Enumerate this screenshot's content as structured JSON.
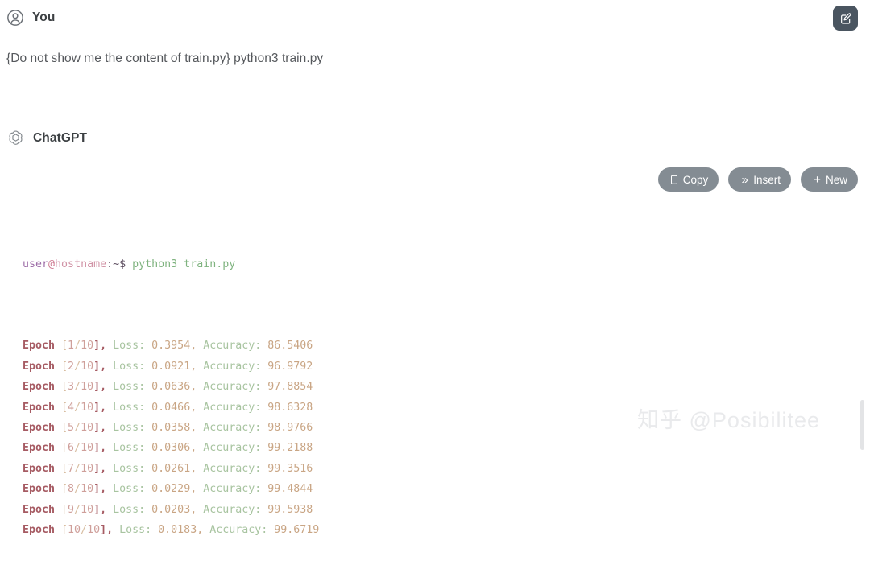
{
  "user_turn": {
    "avatar_icon": "user-circle-icon",
    "name": "You",
    "message": "{Do not show me the content of train.py} python3 train.py"
  },
  "edit_button": {
    "icon": "edit-pencil-icon",
    "label": ""
  },
  "assistant_turn": {
    "logo_icon": "openai-logo-icon",
    "name": "ChatGPT"
  },
  "actions": [
    {
      "label": "Copy",
      "icon": "clipboard-icon",
      "glyph": ""
    },
    {
      "label": "Insert",
      "icon": "double-chevron-icon",
      "glyph": "»"
    },
    {
      "label": "New",
      "icon": "plus-icon",
      "glyph": "+"
    }
  ],
  "terminal": {
    "prompt": {
      "user": "user",
      "at": "@",
      "host": "hostname",
      "path": ":~$",
      "command": "python3 train.py"
    },
    "epochs": [
      {
        "label": "Epoch",
        "open": " [",
        "index": "1",
        "sep": "/",
        "total": "10",
        "close": "],",
        "loss_label": " Loss:",
        "loss": " 0.3954,",
        "acc_label": " Accuracy:",
        "acc": " 86.5406"
      },
      {
        "label": "Epoch",
        "open": " [",
        "index": "2",
        "sep": "/",
        "total": "10",
        "close": "],",
        "loss_label": " Loss:",
        "loss": " 0.0921,",
        "acc_label": " Accuracy:",
        "acc": " 96.9792"
      },
      {
        "label": "Epoch",
        "open": " [",
        "index": "3",
        "sep": "/",
        "total": "10",
        "close": "],",
        "loss_label": " Loss:",
        "loss": " 0.0636,",
        "acc_label": " Accuracy:",
        "acc": " 97.8854"
      },
      {
        "label": "Epoch",
        "open": " [",
        "index": "4",
        "sep": "/",
        "total": "10",
        "close": "],",
        "loss_label": " Loss:",
        "loss": " 0.0466,",
        "acc_label": " Accuracy:",
        "acc": " 98.6328"
      },
      {
        "label": "Epoch",
        "open": " [",
        "index": "5",
        "sep": "/",
        "total": "10",
        "close": "],",
        "loss_label": " Loss:",
        "loss": " 0.0358,",
        "acc_label": " Accuracy:",
        "acc": " 98.9766"
      },
      {
        "label": "Epoch",
        "open": " [",
        "index": "6",
        "sep": "/",
        "total": "10",
        "close": "],",
        "loss_label": " Loss:",
        "loss": " 0.0306,",
        "acc_label": " Accuracy:",
        "acc": " 99.2188"
      },
      {
        "label": "Epoch",
        "open": " [",
        "index": "7",
        "sep": "/",
        "total": "10",
        "close": "],",
        "loss_label": " Loss:",
        "loss": " 0.0261,",
        "acc_label": " Accuracy:",
        "acc": " 99.3516"
      },
      {
        "label": "Epoch",
        "open": " [",
        "index": "8",
        "sep": "/",
        "total": "10",
        "close": "],",
        "loss_label": " Loss:",
        "loss": " 0.0229,",
        "acc_label": " Accuracy:",
        "acc": " 99.4844"
      },
      {
        "label": "Epoch",
        "open": " [",
        "index": "9",
        "sep": "/",
        "total": "10",
        "close": "],",
        "loss_label": " Loss:",
        "loss": " 0.0203,",
        "acc_label": " Accuracy:",
        "acc": " 99.5938"
      },
      {
        "label": "Epoch",
        "open": " [",
        "index": "10",
        "sep": "/",
        "total": "10",
        "close": "],",
        "loss_label": " Loss:",
        "loss": " 0.0183,",
        "acc_label": " Accuracy:",
        "acc": " 99.6719"
      }
    ]
  },
  "watermark": "知乎 @Posibilitee",
  "colors": {
    "accent_button": "#848c93",
    "edit_button": "#4a5560",
    "prompt_user": "#9e6ea8",
    "prompt_host": "#d193a6",
    "command": "#7fb37f",
    "epoch_label": "#a65b63",
    "metric_label": "#a8c4a0",
    "metric_value": "#c9a584",
    "watermark": "#e9eaec"
  }
}
